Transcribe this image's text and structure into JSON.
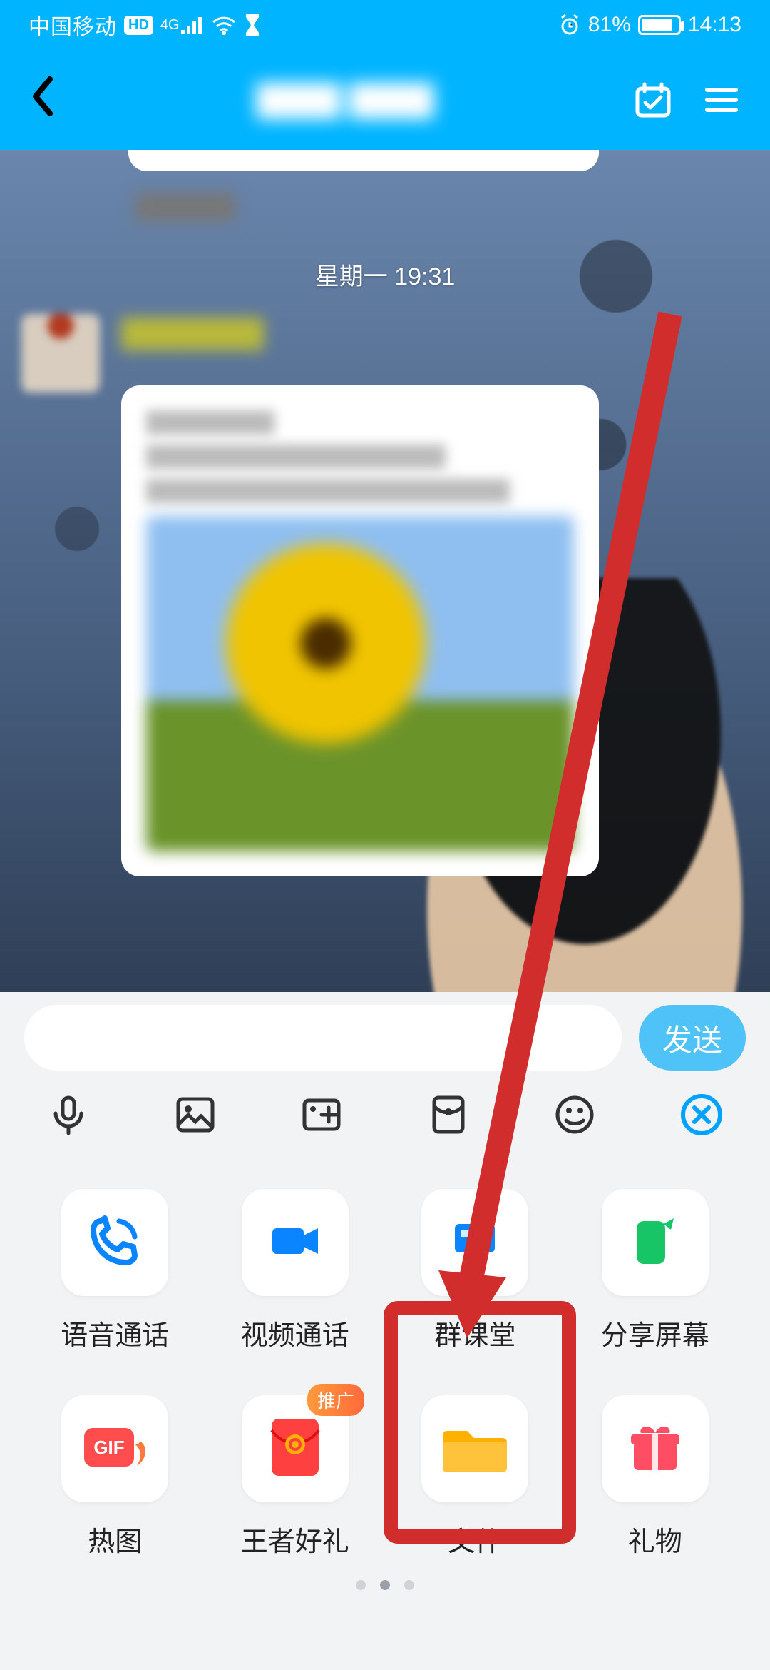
{
  "status": {
    "carrier": "中国移动",
    "hd": "HD",
    "network": "4G",
    "battery_pct": "81%",
    "time": "14:13"
  },
  "nav": {
    "title": "████  ████"
  },
  "chat": {
    "timestamp": "星期一  19:31"
  },
  "input": {
    "send_label": "发送"
  },
  "panel": {
    "tiles": [
      {
        "id": "voice-call",
        "label": "语音通话"
      },
      {
        "id": "video-call",
        "label": "视频通话"
      },
      {
        "id": "classroom",
        "label": "群课堂"
      },
      {
        "id": "share-screen",
        "label": "分享屏幕"
      },
      {
        "id": "hot-gif",
        "label": "热图"
      },
      {
        "id": "king-gift",
        "label": "王者好礼",
        "badge": "推广"
      },
      {
        "id": "file",
        "label": "文件"
      },
      {
        "id": "gift",
        "label": "礼物"
      }
    ]
  },
  "annotation": {
    "highlight_target": "file"
  }
}
